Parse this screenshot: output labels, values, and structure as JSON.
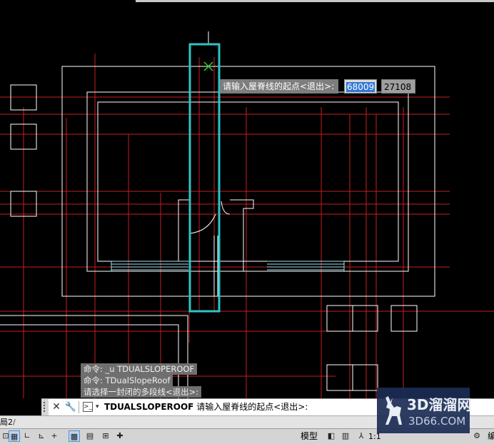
{
  "dynamic_input": {
    "prompt": "请输入屋脊线的起点<退出>:",
    "x_value": "68009",
    "y_value": "27108"
  },
  "history": {
    "line1": "命令: _u TDUALSLOPEROOF",
    "line2": "命令: TDualSlopeRoof",
    "line3": "请选择一封闭的多段线<退出>:"
  },
  "command_line": {
    "command": "TDUALSLOPEROOF",
    "prompt": "请输入屋脊线的起点<退出>:",
    "close_icon": "close-icon",
    "customize_icon": "wrench-icon",
    "prompt_icon": "command-prompt-icon"
  },
  "layout_tabs": {
    "current_partial": "局2",
    "separator": "/"
  },
  "status_bar": {
    "model_label": "模型",
    "scale_label": "1:1",
    "trailing_label": "编"
  },
  "watermark": {
    "title": "3D溜溜网",
    "subtitle": "3D66.COM"
  },
  "colors": {
    "canvas": "#000000",
    "axis_red": "#c81e1e",
    "wall_white": "#ffffff",
    "selection_cyan": "#2ec4c4",
    "crosshair_green": "#2fd12f"
  }
}
